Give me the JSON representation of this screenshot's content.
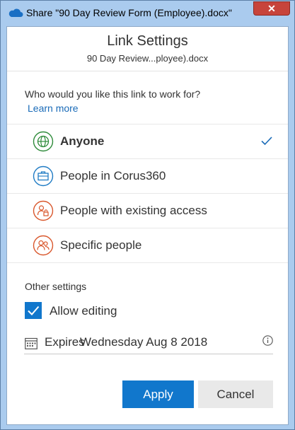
{
  "window": {
    "title": "Share \"90 Day Review Form (Employee).docx\"",
    "close_label": "✕"
  },
  "header": {
    "title": "Link Settings",
    "subtitle": "90 Day Review...ployee).docx"
  },
  "audience": {
    "question": "Who would you like this link to work for?",
    "learn_more": "Learn more",
    "options": [
      {
        "label": "Anyone",
        "icon": "globe-icon",
        "color": "#2e8b3a",
        "selected": true
      },
      {
        "label": "People in Corus360",
        "icon": "briefcase-icon",
        "color": "#1f7bc4",
        "selected": false
      },
      {
        "label": "People with existing access",
        "icon": "people-lock-icon",
        "color": "#d9572c",
        "selected": false
      },
      {
        "label": "Specific people",
        "icon": "people-icon",
        "color": "#d9572c",
        "selected": false
      }
    ]
  },
  "other_settings": {
    "heading": "Other settings",
    "allow_editing_label": "Allow editing",
    "allow_editing_checked": true,
    "expires_label": "Expires",
    "expires_value": "Wednesday Aug 8 2018"
  },
  "buttons": {
    "apply": "Apply",
    "cancel": "Cancel"
  },
  "colors": {
    "accent": "#1177cc",
    "title_bar": "#aacbee",
    "close": "#c7443b"
  }
}
